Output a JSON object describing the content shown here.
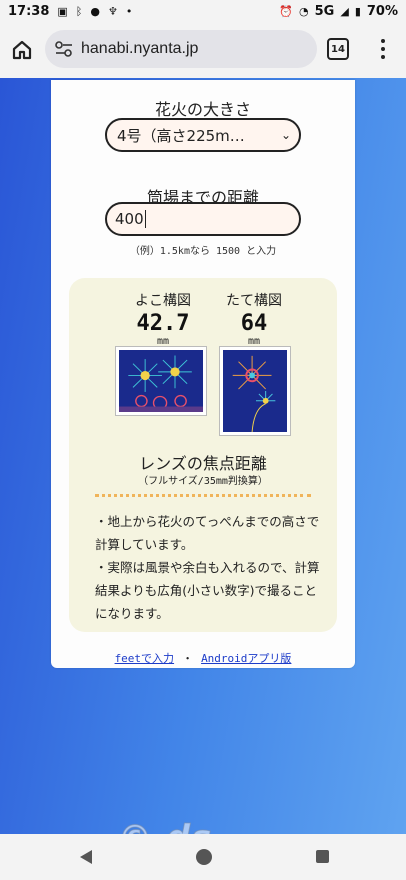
{
  "status": {
    "time": "17:38",
    "network": "5G",
    "battery": "70%"
  },
  "browser": {
    "url": "hanabi.nyanta.jp",
    "tab_count": "14"
  },
  "form": {
    "size_label": "花火の大きさ",
    "size_value": "4号（高さ225m…",
    "distance_label": "筒場までの距離",
    "distance_value": "400",
    "distance_hint": "（例）1.5kmなら 1500 と入力"
  },
  "result": {
    "yoko_title": "よこ構図",
    "yoko_value": "42.7",
    "yoko_unit": "mm",
    "tate_title": "たて構図",
    "tate_value": "64",
    "tate_unit": "mm",
    "lens_title": "レンズの焦点距離",
    "lens_sub": "（フルサイズ/35mm判換算）",
    "note1": "・地上から花火のてっぺんまでの高さで計算しています。",
    "note2": "・実際は風景や余白も入れるので、計算結果よりも広角(小さい数字)で撮ることになります。"
  },
  "links": {
    "feet": "feetで入力",
    "sep": "・",
    "android": "Androidアプリ版"
  },
  "watermark": "© ds-okina.com"
}
